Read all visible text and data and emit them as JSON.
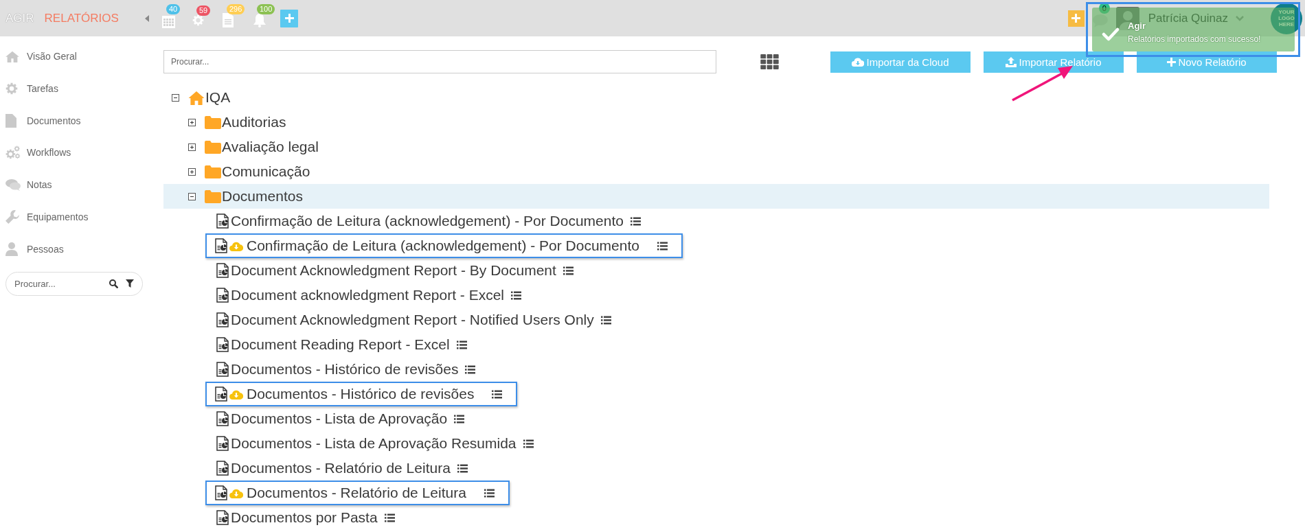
{
  "app": {
    "name": "AGIR",
    "module": "RELATÓRIOS"
  },
  "toolbar_icons": [
    {
      "kind": "calendar",
      "badge": "40",
      "color": "#4fc1e9"
    },
    {
      "kind": "gear",
      "badge": "59",
      "color": "#ed5565"
    },
    {
      "kind": "document",
      "badge": "296",
      "color": "#ffce54"
    },
    {
      "kind": "bell",
      "badge": "100",
      "color": "#8cc152"
    }
  ],
  "user": {
    "chat_badge": "0",
    "name": "Patrícia Quinaz",
    "logo_text": "YOUR LOGO HERE"
  },
  "toast": {
    "title": "Agir",
    "message": "Relatórios importados com sucesso!",
    "highlighted": true
  },
  "sidebar": {
    "items": [
      {
        "kind": "home",
        "label": "Visão Geral"
      },
      {
        "kind": "gear",
        "label": "Tarefas"
      },
      {
        "kind": "file",
        "label": "Documentos"
      },
      {
        "kind": "gears",
        "label": "Workflows"
      },
      {
        "kind": "comments",
        "label": "Notas"
      },
      {
        "kind": "wrench",
        "label": "Equipamentos"
      },
      {
        "kind": "user",
        "label": "Pessoas"
      }
    ],
    "search": {
      "placeholder": "Procurar..."
    }
  },
  "search": {
    "placeholder": "Procurar..."
  },
  "buttons": [
    {
      "kind": "cloud",
      "label": "Importar da Cloud"
    },
    {
      "kind": "upload",
      "label": "Importar Relatório"
    },
    {
      "kind": "plus",
      "label": "Novo Relatório"
    }
  ],
  "tree": [
    {
      "kind": "home",
      "label": "IQA",
      "expanded": true,
      "selected": false,
      "children": [
        {
          "kind": "folder",
          "label": "Auditorias",
          "expanded": false,
          "selected": false
        },
        {
          "kind": "folder",
          "label": "Avaliação legal",
          "expanded": false,
          "selected": false
        },
        {
          "kind": "folder",
          "label": "Comunicação",
          "expanded": false,
          "selected": false
        },
        {
          "kind": "folder",
          "label": "Documentos",
          "expanded": true,
          "selected": true,
          "children": [
            {
              "kind": "report",
              "label": "Confirmação de Leitura (acknowledgement) - Por Documento",
              "selected": false,
              "highlighted": false
            },
            {
              "kind": "imported",
              "label": "Confirmação de Leitura (acknowledgement) - Por Documento",
              "selected": false,
              "highlighted": true
            },
            {
              "kind": "report",
              "label": "Document Acknowledgment Report - By Document",
              "selected": false,
              "highlighted": false
            },
            {
              "kind": "report",
              "label": "Document acknowledgment Report - Excel",
              "selected": false,
              "highlighted": false
            },
            {
              "kind": "report",
              "label": "Document Acknowledgment Report - Notified Users Only",
              "selected": false,
              "highlighted": false
            },
            {
              "kind": "report",
              "label": "Document Reading Report - Excel",
              "selected": false,
              "highlighted": false
            },
            {
              "kind": "report",
              "label": "Documentos - Histórico de revisões",
              "selected": false,
              "highlighted": false
            },
            {
              "kind": "imported",
              "label": "Documentos - Histórico de revisões",
              "selected": false,
              "highlighted": true
            },
            {
              "kind": "report",
              "label": "Documentos - Lista de Aprovação",
              "selected": false,
              "highlighted": false
            },
            {
              "kind": "report",
              "label": "Documentos - Lista de Aprovação Resumida",
              "selected": false,
              "highlighted": false
            },
            {
              "kind": "report",
              "label": "Documentos - Relatório de Leitura",
              "selected": false,
              "highlighted": false
            },
            {
              "kind": "imported",
              "label": "Documentos - Relatório de Leitura",
              "selected": false,
              "highlighted": true
            },
            {
              "kind": "report",
              "label": "Documentos por Pasta",
              "selected": false,
              "highlighted": false
            }
          ]
        }
      ]
    }
  ]
}
